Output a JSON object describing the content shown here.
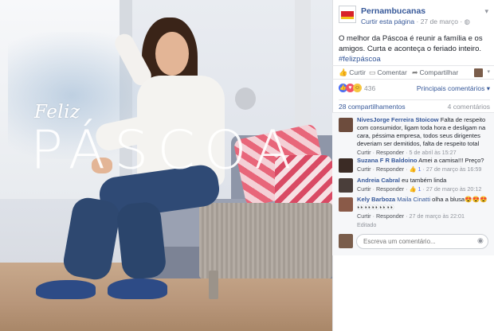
{
  "photo": {
    "overlay_script": "Feliz",
    "overlay_big": "PÁSCOA"
  },
  "post": {
    "page_name": "Pernambucanas",
    "follow_label": "Curtir esta página",
    "sep": "·",
    "date": "27 de março",
    "privacy_sep": "·",
    "text_main": "O melhor da Páscoa é reunir a família e os amigos. Curta e aconteça o feriado inteiro.",
    "hashtag": "#felizpáscoa"
  },
  "actions": {
    "like": "Curtir",
    "comment": "Comentar",
    "share": "Compartilhar"
  },
  "reactions": {
    "count": "436",
    "sort": "Principais comentários"
  },
  "stats": {
    "shares": "28 compartilhamentos",
    "comments": "4 comentários"
  },
  "comments": [
    {
      "name": "NivesJorge Ferreira Stoicow",
      "text": "Falta de respeito com consumidor, ligam toda hora e desligam na cara, péssima empresa, todos seus dirigentes deveriam ser demitidos, falta de respeito total",
      "like": "Curtir",
      "reply": "Responder",
      "reactions": "",
      "date": "5 de abril às 15:27",
      "edited": ""
    },
    {
      "name": "Suzana F R Baldoino",
      "text": "Amei a camisa!!! Preço?",
      "like": "Curtir",
      "reply": "Responder",
      "reactions": "1",
      "date": "27 de março às 16:59",
      "edited": ""
    },
    {
      "name": "Andreia Cabral",
      "text": "eu também linda",
      "like": "Curtir",
      "reply": "Responder",
      "reactions": "1",
      "date": "27 de março às 20:12",
      "edited": ""
    },
    {
      "name": "Kely Barboza",
      "mention": "Maila Cinatti",
      "text": "olha a blusa😍😍😍 👀👀👀👀👀",
      "like": "Curtir",
      "reply": "Responder",
      "reactions": "",
      "date": "27 de março às 22:01",
      "edited": "Editado"
    }
  ],
  "composer": {
    "placeholder": "Escreva um comentário..."
  },
  "colors": {
    "link": "#365899",
    "brand_red": "#d8232a",
    "brand_yellow": "#f2c21b"
  },
  "icons": {
    "like": "thumbs-up-icon",
    "comment": "speech-bubble-icon",
    "share": "share-arrow-icon",
    "camera": "camera-icon",
    "chevron": "chevron-down-icon"
  }
}
